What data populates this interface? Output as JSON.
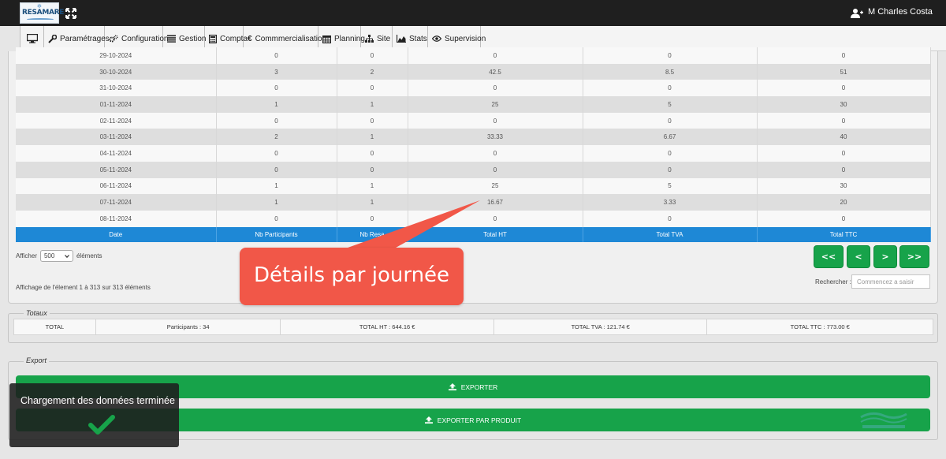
{
  "app": {
    "logo_text": "RESAMARE",
    "user_name": "M Charles Costa"
  },
  "menu": [
    {
      "label": "",
      "icon": "monitor-icon"
    },
    {
      "label": "Paramétrages",
      "icon": "wrench-icon"
    },
    {
      "label": "Configuration",
      "icon": "gears-icon"
    },
    {
      "label": "Gestion",
      "icon": "list-icon"
    },
    {
      "label": "Compta",
      "icon": "calculator-icon"
    },
    {
      "label": "Commmercialisation",
      "icon": "euro-icon"
    },
    {
      "label": "Planning",
      "icon": "calendar-icon"
    },
    {
      "label": "Site",
      "icon": "sitemap-icon"
    },
    {
      "label": "Stats",
      "icon": "area-chart-icon"
    },
    {
      "label": "Supervision",
      "icon": "eye-icon"
    }
  ],
  "table": {
    "rows": [
      [
        "29-10-2024",
        "0",
        "0",
        "0",
        "0",
        "0"
      ],
      [
        "30-10-2024",
        "3",
        "2",
        "42.5",
        "8.5",
        "51"
      ],
      [
        "31-10-2024",
        "0",
        "0",
        "0",
        "0",
        "0"
      ],
      [
        "01-11-2024",
        "1",
        "1",
        "25",
        "5",
        "30"
      ],
      [
        "02-11-2024",
        "0",
        "0",
        "0",
        "0",
        "0"
      ],
      [
        "03-11-2024",
        "2",
        "1",
        "33.33",
        "6.67",
        "40"
      ],
      [
        "04-11-2024",
        "0",
        "0",
        "0",
        "0",
        "0"
      ],
      [
        "05-11-2024",
        "0",
        "0",
        "0",
        "0",
        "0"
      ],
      [
        "06-11-2024",
        "1",
        "1",
        "25",
        "5",
        "30"
      ],
      [
        "07-11-2024",
        "1",
        "1",
        "16.67",
        "3.33",
        "20"
      ],
      [
        "08-11-2024",
        "0",
        "0",
        "0",
        "0",
        "0"
      ]
    ],
    "headers": [
      "Date",
      "Nb Participants",
      "Nb Resa",
      "Total HT",
      "Total TVA",
      "Total TTC"
    ]
  },
  "controls": {
    "afficher_label": "Afficher",
    "page_size": "500",
    "elements_label": "éléments",
    "info": "Affichage de l'élement 1 à 313 sur 313 éléments",
    "search_label": "Rechercher :",
    "search_placeholder": "Commencez a saisir",
    "pager": {
      "first": "<<",
      "prev": "<",
      "next": ">",
      "last": ">>"
    }
  },
  "callout": {
    "text": "Détails par journée"
  },
  "totaux": {
    "legend": "Totaux",
    "total": "TOTAL",
    "participants": "Participants : 34",
    "total_ht": "TOTAL HT : 644.16 €",
    "total_tva": "TOTAL TVA : 121.74 €",
    "total_ttc": "TOTAL TTC : 773.00 €"
  },
  "export": {
    "legend": "Export",
    "exporter": "EXPORTER",
    "exporter_produit": "EXPORTER PAR PRODUIT"
  },
  "toast": {
    "text": "Chargement des données terminée"
  },
  "colors": {
    "topbar": "#1f1f1f",
    "table_header": "#1e88d6",
    "button_green": "#17a34a",
    "callout_red": "#f15748"
  }
}
